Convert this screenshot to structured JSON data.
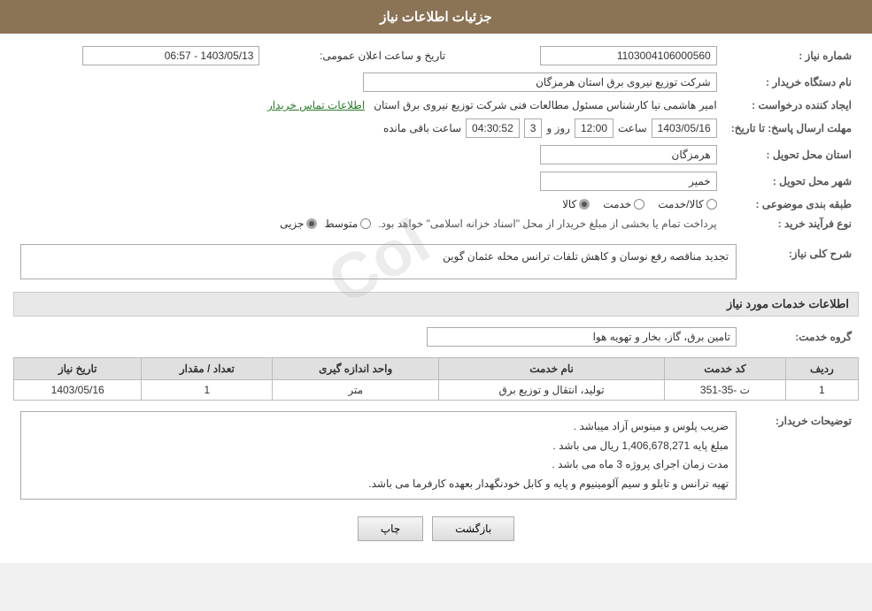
{
  "header": {
    "title": "جزئیات اطلاعات نیاز"
  },
  "fields": {
    "need_number_label": "شماره نیاز :",
    "need_number_value": "1103004106000560",
    "buyer_org_label": "نام دستگاه خریدار :",
    "buyer_org_value": "شرکت توزیع نیروی برق استان هرمزگان",
    "creator_label": "ایجاد کننده درخواست :",
    "creator_value": "امیر هاشمی نیا کارشناس مسئول مطالعات فنی شرکت توزیع نیروی برق استان",
    "contact_link": "اطلاعات تماس خریدار",
    "send_date_label": "مهلت ارسال پاسخ: تا تاریخ:",
    "date_value": "1403/05/16",
    "time_label": "ساعت",
    "time_value": "12:00",
    "days_label": "روز و",
    "days_value": "3",
    "remaining_label": "ساعت باقی مانده",
    "remaining_value": "04:30:52",
    "delivery_province_label": "استان محل تحویل :",
    "delivery_province_value": "هرمزگان",
    "delivery_city_label": "شهر محل تحویل :",
    "delivery_city_value": "خمیر",
    "category_label": "طبقه بندی موضوعی :",
    "category_options": [
      "کالا",
      "خدمت",
      "کالا/خدمت"
    ],
    "category_selected": "کالا",
    "process_label": "نوع فرآیند خرید :",
    "process_options": [
      "جزیی",
      "متوسط"
    ],
    "process_note": "پرداخت تمام یا بخشی از مبلغ خریدار از محل \"اسناد خزانه اسلامی\" خواهد بود.",
    "description_label": "شرح کلی نیاز:",
    "description_value": "تجدید مناقصه رفع نوسان و کاهش تلفات ترانس محله عثمان گوین",
    "services_title": "اطلاعات خدمات مورد نیاز",
    "service_group_label": "گروه خدمت:",
    "service_group_value": "تامین برق، گاز، بخار و تهویه هوا",
    "table": {
      "headers": [
        "ردیف",
        "کد خدمت",
        "نام خدمت",
        "واحد اندازه گیری",
        "تعداد / مقدار",
        "تاریخ نیاز"
      ],
      "rows": [
        {
          "row": "1",
          "code": "ت -35-351",
          "name": "تولید، انتقال و توزیع برق",
          "unit": "متر",
          "qty": "1",
          "date": "1403/05/16"
        }
      ]
    },
    "buyer_notes_label": "توضیحات خریدار:",
    "buyer_notes": [
      "ضریب پلوس و مینوس آزاد میباشد .",
      "مبلغ پایه 1,406,678,271 ریال می باشد .",
      "مدت زمان اجرای پروژه 3 ماه می باشد .",
      "تهیه ترانس و تابلو و سیم آلومینیوم و پایه و کابل خودنگهدار بعهده کارفرما می باشد."
    ],
    "btn_back": "بازگشت",
    "btn_print": "چاپ",
    "announce_date_label": "تاریخ و ساعت اعلان عمومی:",
    "announce_date_value": "1403/05/13 - 06:57"
  },
  "watermark": "Col"
}
